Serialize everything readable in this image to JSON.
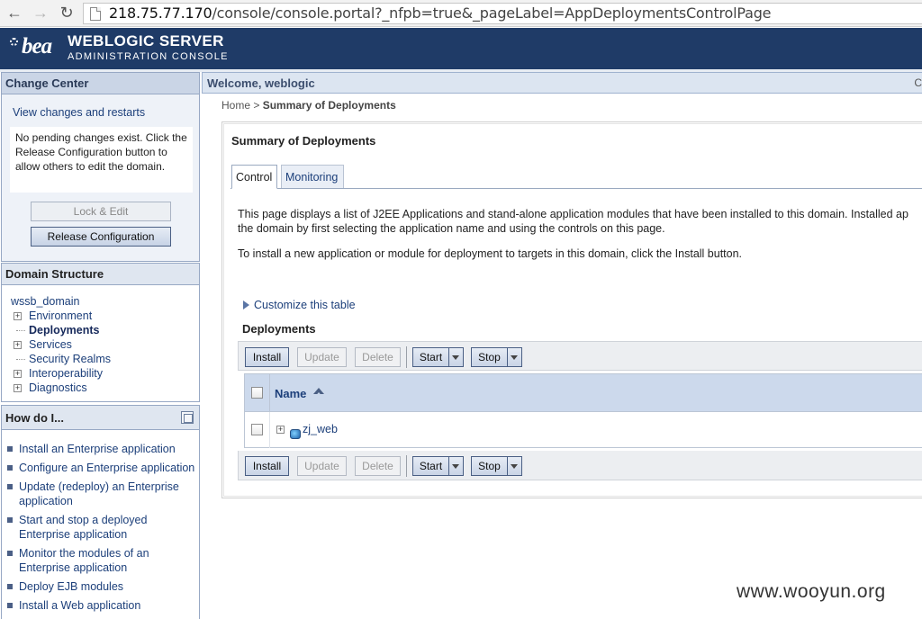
{
  "browser": {
    "url_host": "218.75.77.170",
    "url_path": "/console/console.portal?_nfpb=true&_pageLabel=AppDeploymentsControlPage"
  },
  "header": {
    "logo": "bea",
    "title": "WEBLOGIC SERVER",
    "subtitle": "ADMINISTRATION CONSOLE",
    "bg_color": "#1f3b67"
  },
  "change_center": {
    "title": "Change Center",
    "link": "View changes and restarts",
    "message": "No pending changes exist. Click the Release Configuration button to allow others to edit the domain.",
    "lock_button": "Lock & Edit",
    "release_button": "Release Configuration"
  },
  "domain_structure": {
    "title": "Domain Structure",
    "root": "wssb_domain",
    "items": [
      {
        "label": "Environment",
        "expandable": true
      },
      {
        "label": "Deployments",
        "expandable": false,
        "active": true
      },
      {
        "label": "Services",
        "expandable": true
      },
      {
        "label": "Security Realms",
        "expandable": false
      },
      {
        "label": "Interoperability",
        "expandable": true
      },
      {
        "label": "Diagnostics",
        "expandable": true
      }
    ]
  },
  "how_do_i": {
    "title": "How do I...",
    "items": [
      "Install an Enterprise application",
      "Configure an Enterprise application",
      "Update (redeploy) an Enterprise application",
      "Start and stop a deployed Enterprise application",
      "Monitor the modules of an Enterprise application",
      "Deploy EJB modules",
      "Install a Web application"
    ]
  },
  "welcome": {
    "text": "Welcome, weblogic",
    "extra": "C"
  },
  "breadcrumb": {
    "home": "Home",
    "separator": " > ",
    "current": "Summary of Deployments"
  },
  "main": {
    "title": "Summary of Deployments",
    "tabs": [
      "Control",
      "Monitoring"
    ],
    "description_line1": "This page displays a list of J2EE Applications and stand-alone application modules that have been installed to this domain. Installed ap",
    "description_line2": "the domain by first selecting the application name and using the controls on this page.",
    "install_hint": "To install a new application or module for deployment to targets in this domain, click the Install button.",
    "customize_link": "Customize this table",
    "deployments_title": "Deployments"
  },
  "toolbar": {
    "install": "Install",
    "update": "Update",
    "delete": "Delete",
    "start": "Start",
    "stop": "Stop"
  },
  "table": {
    "columns": [
      "Name"
    ],
    "rows": [
      {
        "name": "zj_web"
      }
    ]
  },
  "watermark": "www.wooyun.org"
}
